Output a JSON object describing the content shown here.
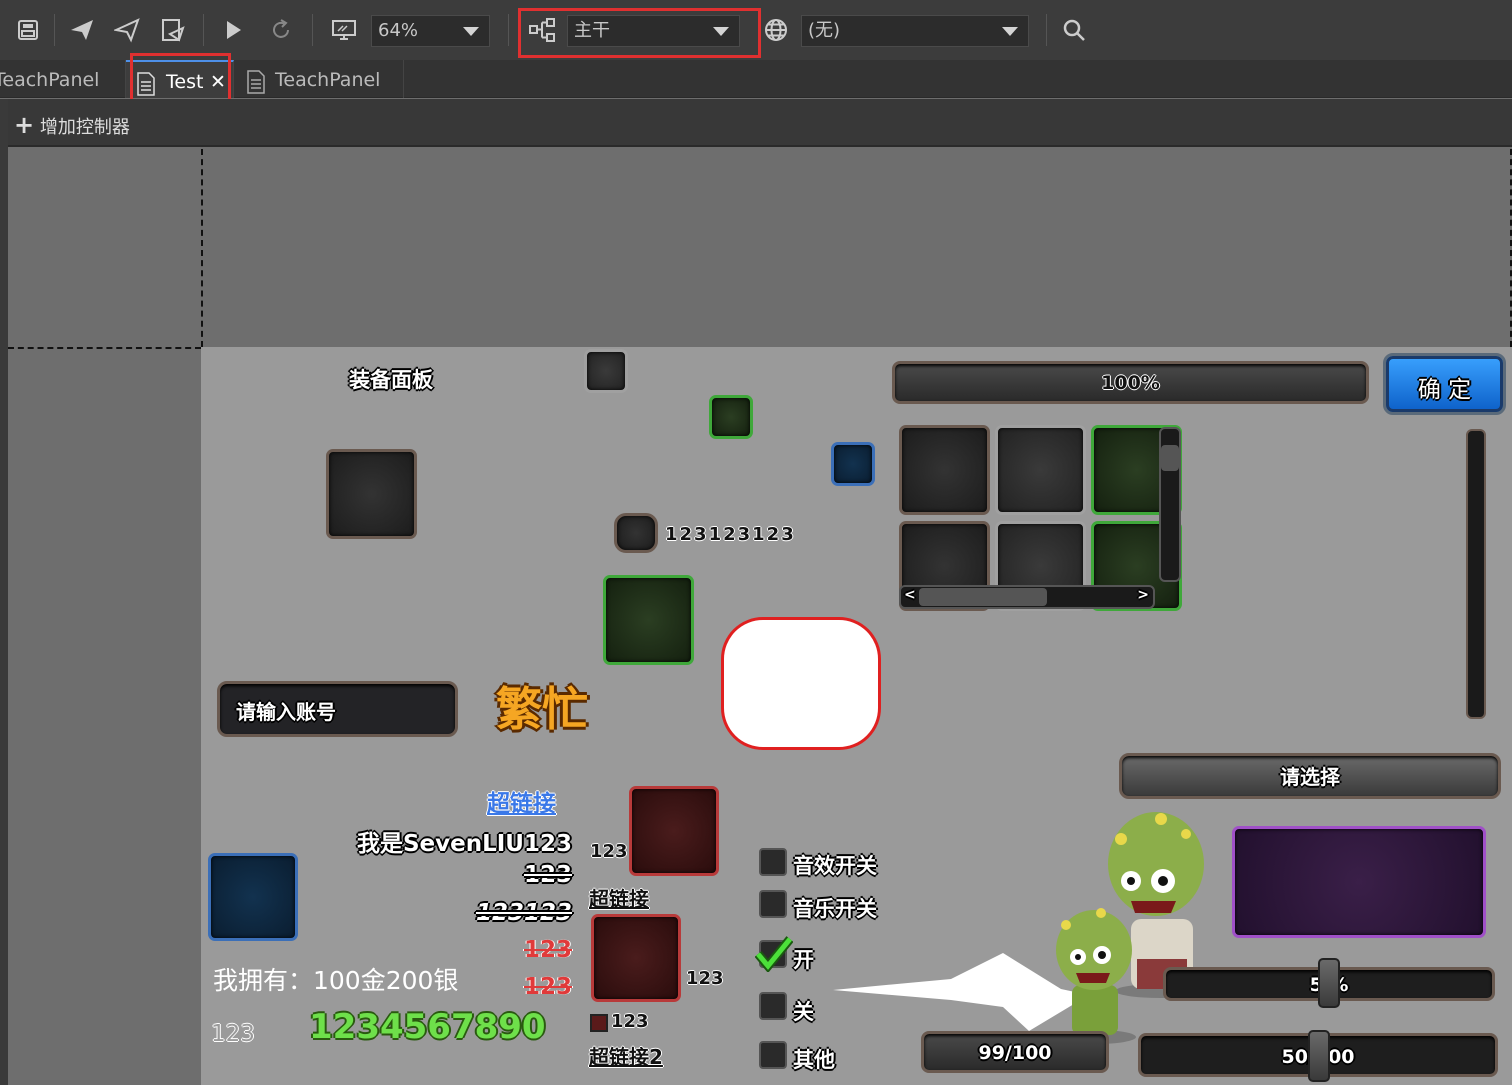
{
  "toolbar": {
    "zoom": "64%",
    "branch": "主干",
    "language": "(无)"
  },
  "tabs": [
    {
      "label": "TeachPanel"
    },
    {
      "label": "Test",
      "close": "✕"
    },
    {
      "label": "TeachPanel"
    }
  ],
  "ctrlbar": {
    "plus": "+",
    "label": "增加控制器"
  },
  "panel": {
    "title": "装备面板",
    "progress_top": "100%",
    "confirm_button": "确 定",
    "numbers_text": "123123123",
    "input_placeholder": "请输入账号",
    "busy_text": "繁忙",
    "select_label": "请选择",
    "link1": "超链接",
    "richtext1": "我是SevenLIU123",
    "text_123_a": "123",
    "text_123123": "123123",
    "text_123_red1": "123",
    "text_123_red2": "123",
    "gold_text": "我拥有：100金200银",
    "small_123": "123",
    "green_digits": "1234567890",
    "label_123_b": "123",
    "link2": "超链接",
    "label_123_c": "123",
    "label_123_d": "123",
    "link3": "超链接2",
    "checkboxes": [
      {
        "label": "音效开关",
        "checked": false
      },
      {
        "label": "音乐开关",
        "checked": false
      },
      {
        "label": "开",
        "checked": true
      },
      {
        "label": "关",
        "checked": false
      },
      {
        "label": "其他",
        "checked": false
      }
    ],
    "slider1_text": "5  %",
    "slider1_value": 0.5,
    "hp_text": "99/100",
    "hp_value": 0.99,
    "slider2_text": "50/100",
    "slider2_value": 0.5,
    "scroll_left": "<",
    "scroll_right": ">"
  },
  "colors": {
    "highlight_box": "#e03030",
    "accent_blue": "#4e90e8"
  }
}
